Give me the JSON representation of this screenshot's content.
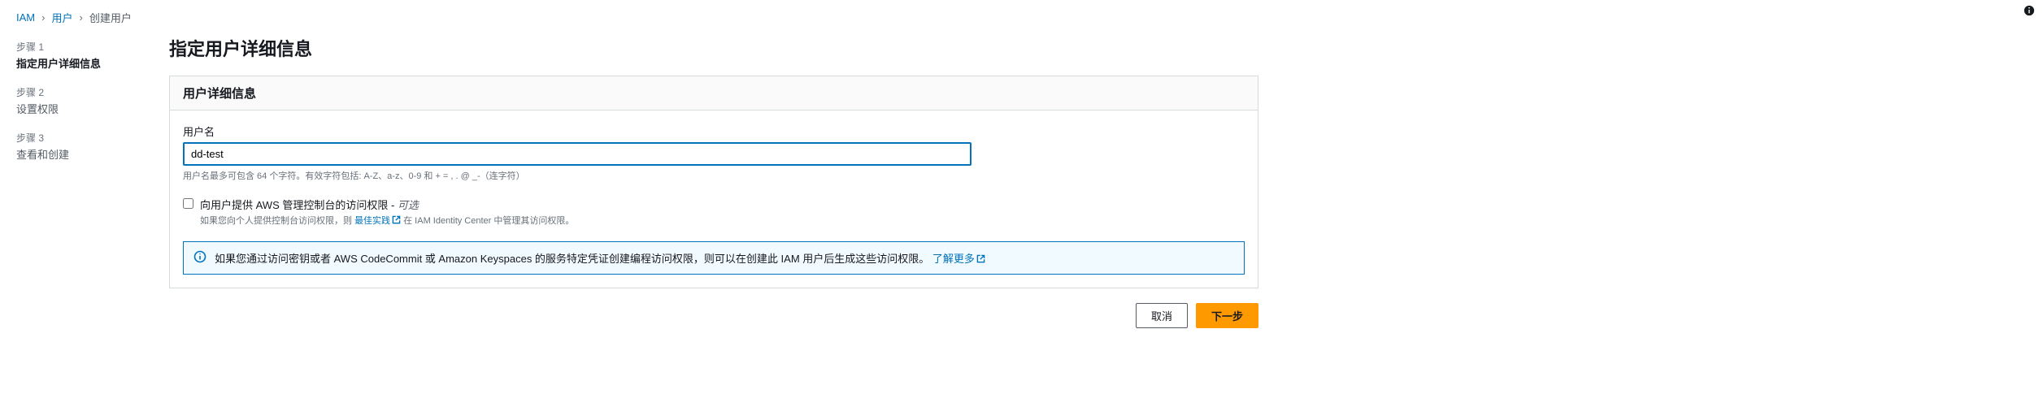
{
  "breadcrumb": {
    "root": "IAM",
    "users": "用户",
    "current": "创建用户"
  },
  "steps": [
    {
      "label": "步骤 1",
      "title": "指定用户详细信息",
      "active": true
    },
    {
      "label": "步骤 2",
      "title": "设置权限",
      "active": false
    },
    {
      "label": "步骤 3",
      "title": "查看和创建",
      "active": false
    }
  ],
  "page_title": "指定用户详细信息",
  "panel": {
    "header": "用户详细信息",
    "username_label": "用户名",
    "username_value": "dd-test",
    "username_help": "用户名最多可包含 64 个字符。有效字符包括: A-Z、a-z、0-9 和 + = , . @ _-（连字符）"
  },
  "console_access": {
    "label_main": "向用户提供 AWS 管理控制台的访问权限 - ",
    "label_optional": "可选",
    "help_prefix": "如果您向个人提供控制台访问权限，则 ",
    "best_practice": "最佳实践",
    "help_suffix": " 在 IAM Identity Center 中管理其访问权限。"
  },
  "info_box": {
    "text": "如果您通过访问密钥或者 AWS CodeCommit 或 Amazon Keyspaces 的服务特定凭证创建编程访问权限，则可以在创建此 IAM 用户后生成这些访问权限。",
    "learn_more": "了解更多"
  },
  "buttons": {
    "cancel": "取消",
    "next": "下一步"
  }
}
